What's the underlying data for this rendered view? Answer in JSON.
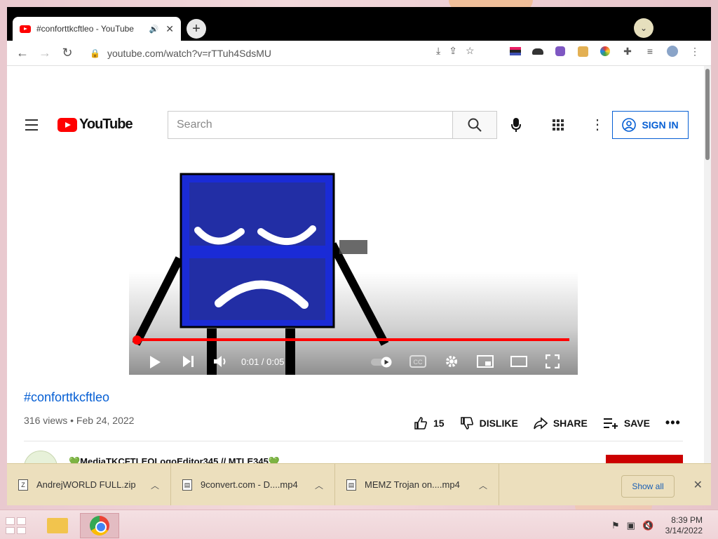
{
  "browser": {
    "tab_title": "#conforttkcftleo - YouTube",
    "tab_audio_icon": "speaker-icon",
    "tab_close": "✕",
    "new_tab": "+",
    "tab_search": "⌄",
    "url": "youtube.com/watch?v=rTTuh4SdsMU"
  },
  "youtube": {
    "logo_text": "YouTube",
    "search_placeholder": "Search",
    "sign_in": "SIGN IN",
    "player": {
      "time": "0:01 / 0:05",
      "progress": 0.02
    },
    "video_title": "#conforttkcftleo",
    "meta": "316 views • Feb 24, 2022",
    "likes": "15",
    "dislike": "DISLIKE",
    "share": "SHARE",
    "save": "SAVE",
    "channel_name": "💚MediaTKCFTLEOLogoEditor345 // MTLE345💚"
  },
  "downloads": {
    "items": [
      {
        "name": "AndrejWORLD FULL.zip"
      },
      {
        "name": "9convert.com - D....mp4"
      },
      {
        "name": "MEMZ Trojan on....mp4"
      }
    ],
    "show_all": "Show all",
    "close": "✕"
  },
  "taskbar": {
    "time": "8:39 PM",
    "date": "3/14/2022"
  }
}
